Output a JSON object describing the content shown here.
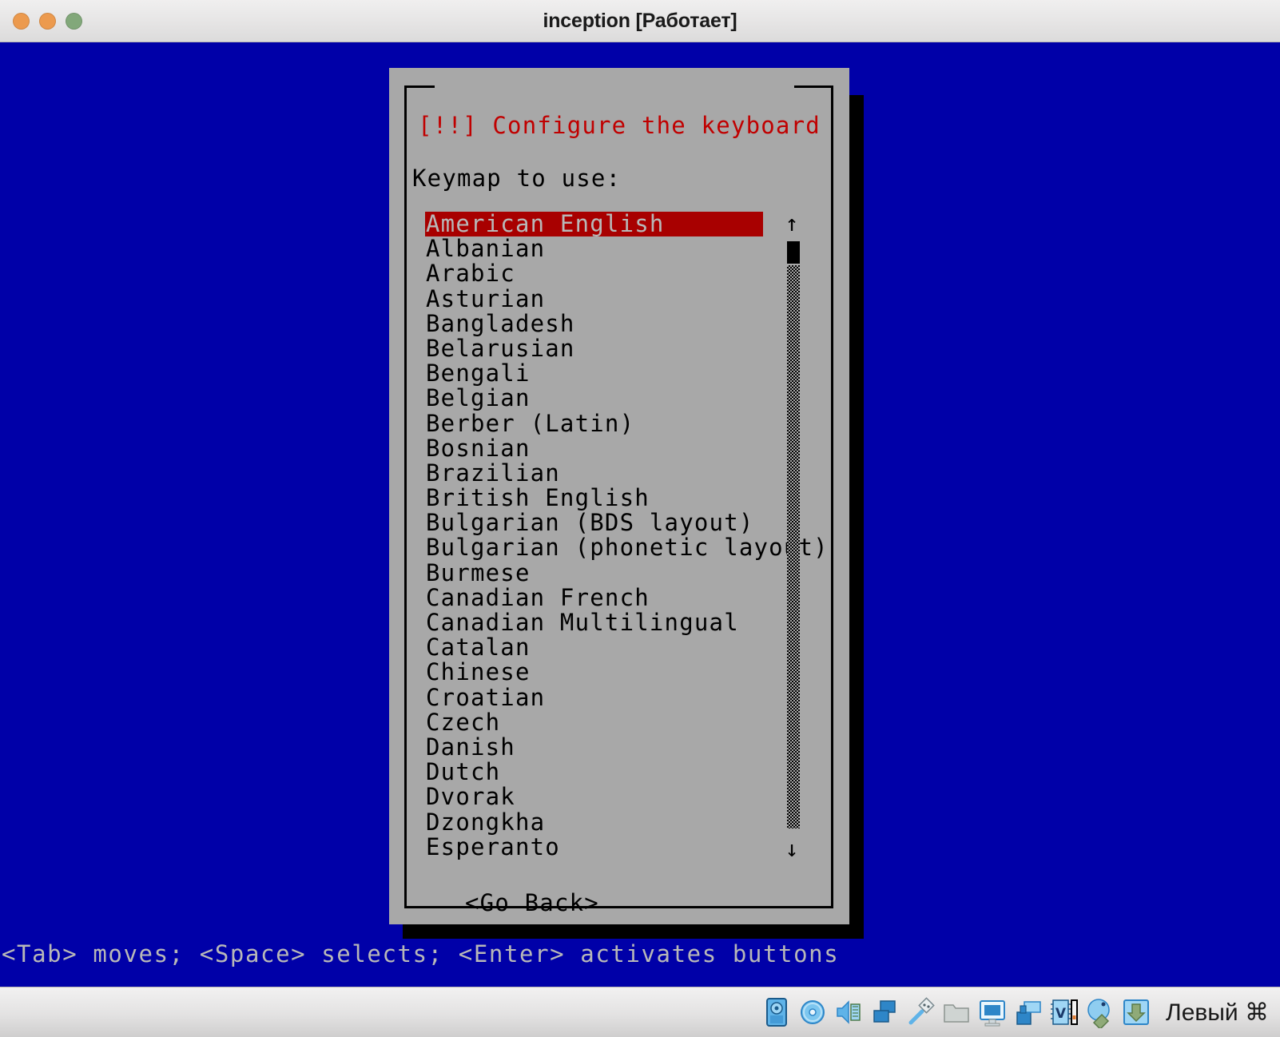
{
  "window": {
    "title": "inception [Работает]",
    "traffic_lights": [
      {
        "name": "close",
        "color": "#ec9a4e"
      },
      {
        "name": "minimize",
        "color": "#ec9a4e"
      },
      {
        "name": "zoom",
        "color": "#82a87a"
      }
    ]
  },
  "colors": {
    "console_background": "#0000A8",
    "dialog_background": "#a8a8a8",
    "dialog_title_red": "#c00000",
    "selection_background": "#a80000",
    "selection_text": "#b8b8b8",
    "console_text": "#b8b8b8",
    "border_black": "#000000"
  },
  "dialog": {
    "title": "[!!] Configure the keyboard",
    "prompt": "Keymap to use:",
    "selected_index": 0,
    "items": [
      "American English",
      "Albanian",
      "Arabic",
      "Asturian",
      "Bangladesh",
      "Belarusian",
      "Bengali",
      "Belgian",
      "Berber (Latin)",
      "Bosnian",
      "Brazilian",
      "British English",
      "Bulgarian (BDS layout)",
      "Bulgarian (phonetic layout)",
      "Burmese",
      "Canadian French",
      "Canadian Multilingual",
      "Catalan",
      "Chinese",
      "Croatian",
      "Czech",
      "Danish",
      "Dutch",
      "Dvorak",
      "Dzongkha",
      "Esperanto"
    ],
    "scroll": {
      "up_arrow": "↑",
      "down_arrow": "↓"
    },
    "go_back_label": "<Go Back>"
  },
  "console": {
    "help_line": "<Tab> moves; <Space> selects; <Enter> activates buttons"
  },
  "statusbar": {
    "host_key_label": "Левый ⌘",
    "icons": [
      "hard-disk-icon",
      "optical-disk-icon",
      "audio-icon",
      "network-icon",
      "usb-icon",
      "shared-folders-icon",
      "display-icon",
      "video-capture-icon",
      "virtualization-icon",
      "mouse-integration-icon",
      "host-key-icon"
    ]
  }
}
